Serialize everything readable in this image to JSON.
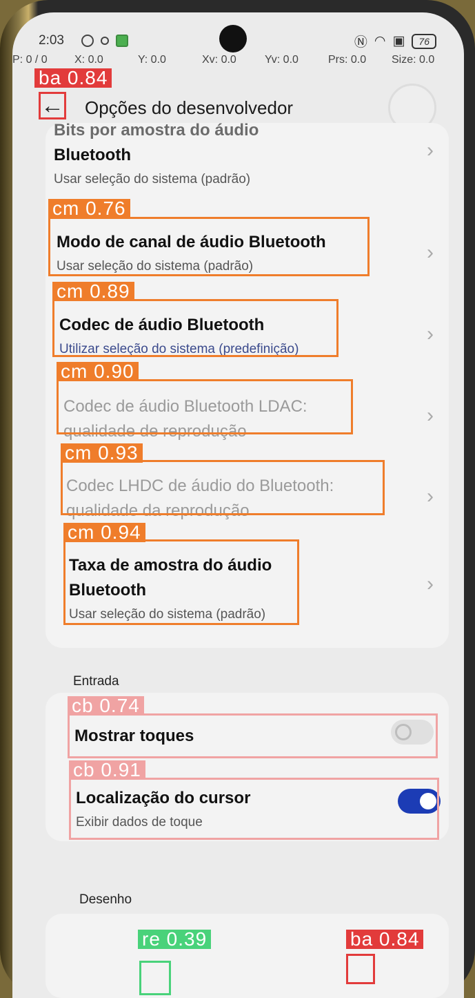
{
  "status_bar": {
    "time": "2:03",
    "battery": "76"
  },
  "pointer_info": {
    "p": "P: 0 / 0",
    "x": "X: 0.0",
    "y": "Y: 0.0",
    "xv": "Xv: 0.0",
    "yv": "Yv: 0.0",
    "prs": "Prs: 0.0",
    "size": "Size: 0.0"
  },
  "header": {
    "back_icon": "←",
    "title": "Opções do desenvolvedor"
  },
  "audio_items": [
    {
      "title_line1": "Bits por amostra do áudio",
      "title_line2": "Bluetooth",
      "subtitle": "Usar seleção do sistema (padrão)"
    },
    {
      "title": "Modo de canal de áudio Bluetooth",
      "subtitle": "Usar seleção do sistema (padrão)"
    },
    {
      "title": "Codec de áudio Bluetooth",
      "subtitle": "Utilizar seleção do sistema (predefinição)"
    },
    {
      "title_line1": "Codec de áudio Bluetooth LDAC:",
      "title_line2": "qualidade de reprodução"
    },
    {
      "title_line1": "Codec LHDC de áudio do Bluetooth:",
      "title_line2": "qualidade da reprodução"
    },
    {
      "title_line1": "Taxa de amostra do áudio",
      "title_line2": "Bluetooth",
      "subtitle": "Usar seleção do sistema (padrão)"
    }
  ],
  "input_section": {
    "heading": "Entrada",
    "show_touches": {
      "title": "Mostrar toques",
      "enabled": false
    },
    "pointer_location": {
      "title": "Localização do cursor",
      "subtitle": "Exibir dados de toque",
      "enabled": true
    }
  },
  "drawing_section": {
    "heading": "Desenho"
  },
  "detections": {
    "back": "ba 0.84",
    "item1": "cm 0.76",
    "item2": "cm 0.89",
    "item3": "cm 0.90",
    "item4": "cm 0.93",
    "item5": "cm 0.94",
    "toggle1": "cb 0.74",
    "toggle2": "cb 0.91",
    "nav_recent": "re 0.39",
    "nav_back": "ba 0.84"
  },
  "colors": {
    "detection_orange": "#ef7d2b",
    "detection_pink": "#f0a3a3",
    "detection_red": "#e23b3b",
    "detection_green": "#49d27a",
    "toggle_on": "#1c3cb5"
  }
}
